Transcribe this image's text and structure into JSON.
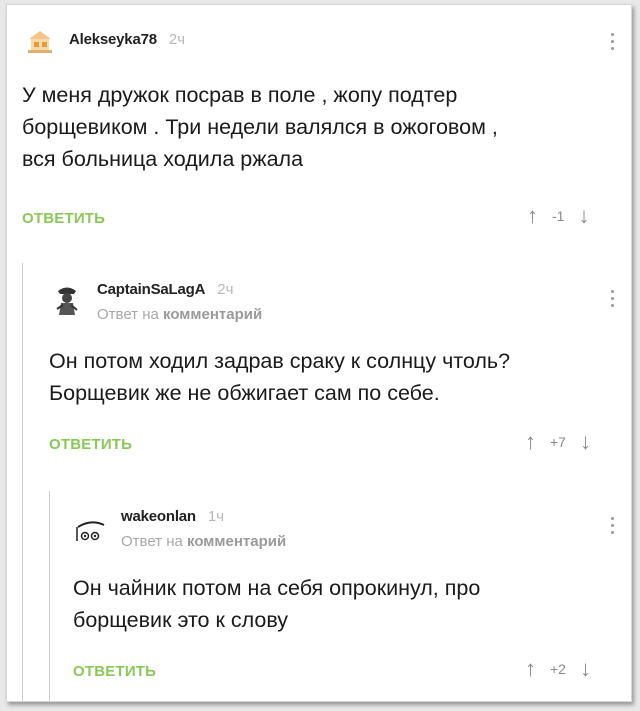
{
  "comments": [
    {
      "username": "Alekseyka78",
      "time": "2ч",
      "avatar_icon": "house-avatar-icon",
      "text": [
        "У меня дружок посрав в поле , жопу подтер",
        "борщевиком . Три недели валялся в ожоговом ,",
        "вся больница ходила ржала"
      ],
      "reply_label": "ОТВЕТИТЬ",
      "votes": "-1"
    },
    {
      "username": "CaptainSaLagA",
      "time": "2ч",
      "avatar_icon": "pirate-avatar-icon",
      "reply_to_prefix": "Ответ на",
      "reply_to_link": "комментарий",
      "text": [
        "Он потом ходил задрав сраку к солнцу чтоль?",
        "Борщевик же не обжигает сам по себе."
      ],
      "reply_label": "ОТВЕТИТЬ",
      "votes": "+7"
    },
    {
      "username": "wakeonlan",
      "time": "1ч",
      "avatar_icon": "face-avatar-icon",
      "reply_to_prefix": "Ответ на",
      "reply_to_link": "комментарий",
      "text": [
        "Он чайник потом на себя опрокинул, про",
        "борщевик это к слову"
      ],
      "reply_label": "ОТВЕТИТЬ",
      "votes": "+2"
    }
  ],
  "icons": {
    "upvote": "↑",
    "downvote": "↓"
  },
  "colors": {
    "reply": "#8ac858",
    "meta": "#a8a8a8"
  }
}
